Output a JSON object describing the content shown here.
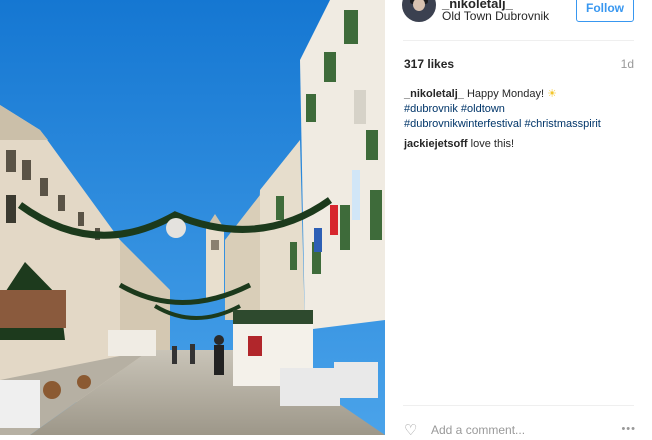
{
  "post": {
    "username": "_nikoletalj_",
    "location": "Old Town Dubrovnik",
    "follow_label": "Follow",
    "likes": "317 likes",
    "age": "1d",
    "caption": {
      "user": "_nikoletalj_",
      "text": "Happy Monday!",
      "emoji": "☀",
      "tags_line1": [
        "#dubrovnik",
        "#oldtown"
      ],
      "tags_line2": [
        "#dubrovnikwinterfestival",
        "#christmasspirit"
      ]
    },
    "comment": {
      "user": "jackiejetsoff",
      "text": "love this!"
    },
    "add_comment_placeholder": "Add a comment...",
    "more_label": "•••",
    "like_icon": "heart-icon"
  },
  "colors": {
    "accent": "#3897f0",
    "hashtag": "#003569",
    "sky": "#1a8fe0"
  }
}
